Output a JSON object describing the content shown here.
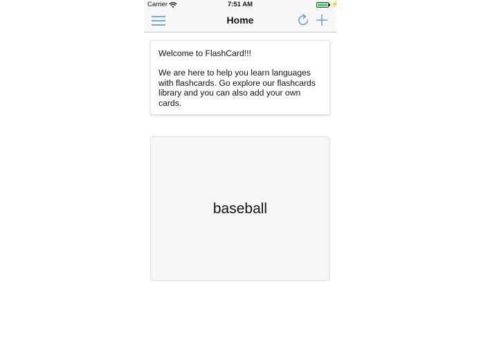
{
  "status_bar": {
    "carrier": "Carrier",
    "time": "7:51 AM",
    "charge_symbol": "⚡",
    "wifi_icon": "wifi-icon",
    "battery_icon": "battery-icon",
    "battery_level": 1.0
  },
  "nav": {
    "title": "Home",
    "menu_icon": "hamburger-menu-icon",
    "refresh_icon": "refresh-icon",
    "add_icon": "plus-icon"
  },
  "welcome": {
    "title": "Welcome to FlashCard!!!",
    "body": "We are here to help you learn languages with flashcards. Go explore our flashcards library and you can also add your own cards."
  },
  "flashcard": {
    "word": "baseball"
  },
  "colors": {
    "accent": "#4a90d9",
    "battery_green": "#4cd964",
    "nav_background": "#f7f7f7",
    "card_background": "#f6f6f6"
  }
}
